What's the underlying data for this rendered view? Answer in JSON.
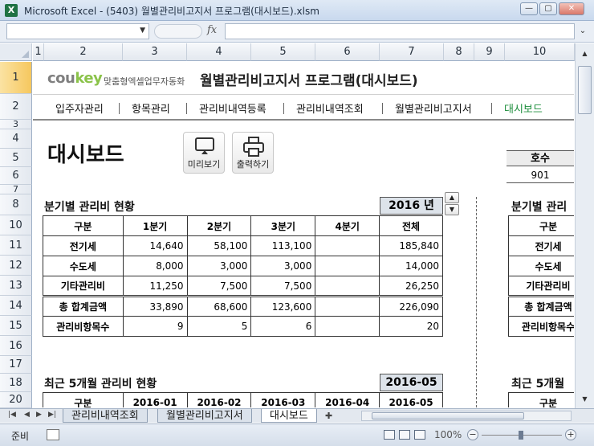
{
  "window": {
    "title": "Microsoft Excel - (5403) 월별관리비고지서 프로그램(대시보드).xlsm",
    "minimize": "—",
    "restore": "▢",
    "close": "✕"
  },
  "formula_bar": {
    "name_box": "",
    "fx_label": "fx",
    "formula": ""
  },
  "columns": [
    "1",
    "2",
    "3",
    "4",
    "5",
    "6",
    "7",
    "8",
    "9",
    "10"
  ],
  "rows": [
    "1",
    "2",
    "3",
    "4",
    "5",
    "6",
    "7",
    "8",
    "10",
    "11",
    "12",
    "13",
    "14",
    "15",
    "16",
    "17",
    "18",
    "20"
  ],
  "header": {
    "logo_main": "cou",
    "logo_key": "key",
    "logo_sub": "맞춤형엑셀업무자동화",
    "app_title": "월별관리비고지서 프로그램(대시보드)"
  },
  "nav": {
    "items": [
      {
        "label": "입주자관리"
      },
      {
        "label": "항목관리"
      },
      {
        "label": "관리비내역등록"
      },
      {
        "label": "관리비내역조회"
      },
      {
        "label": "월별관리비고지서"
      },
      {
        "label": "대시보드"
      }
    ],
    "separator": "|"
  },
  "page": {
    "title": "대시보드",
    "preview_label": "미리보기",
    "print_label": "출력하기"
  },
  "quarterly": {
    "title": "분기별 관리비 현황",
    "year": "2016",
    "year_unit": "년",
    "headers": [
      "구분",
      "1분기",
      "2분기",
      "3분기",
      "4분기",
      "전체"
    ],
    "rows": [
      [
        "전기세",
        "14,640",
        "58,100",
        "113,100",
        "",
        "185,840"
      ],
      [
        "수도세",
        "8,000",
        "3,000",
        "3,000",
        "",
        "14,000"
      ],
      [
        "기타관리비",
        "11,250",
        "7,500",
        "7,500",
        "",
        "26,250"
      ],
      [
        "총 합계금액",
        "33,890",
        "68,600",
        "123,600",
        "",
        "226,090"
      ],
      [
        "관리비항목수",
        "9",
        "5",
        "6",
        "",
        "20"
      ]
    ]
  },
  "recent": {
    "title": "최근 5개월 관리비 현황",
    "month": "2016-05",
    "headers": [
      "구분",
      "2016-01",
      "2016-02",
      "2016-03",
      "2016-04",
      "2016-05"
    ]
  },
  "right_panel": {
    "unit_header": "호수",
    "unit_value": "901",
    "quarterly_title": "분기별 관리",
    "recent_title": "최근 5개월",
    "labels": [
      "구분",
      "전기세",
      "수도세",
      "기타관리비",
      "총 합계금액",
      "관리비항목수"
    ],
    "recent_header": "구분"
  },
  "sheet_tabs": [
    {
      "label": "관리비내역조회"
    },
    {
      "label": "월별관리비고지서"
    },
    {
      "label": "대시보드"
    }
  ],
  "status": {
    "ready": "준비",
    "zoom": "100%"
  }
}
